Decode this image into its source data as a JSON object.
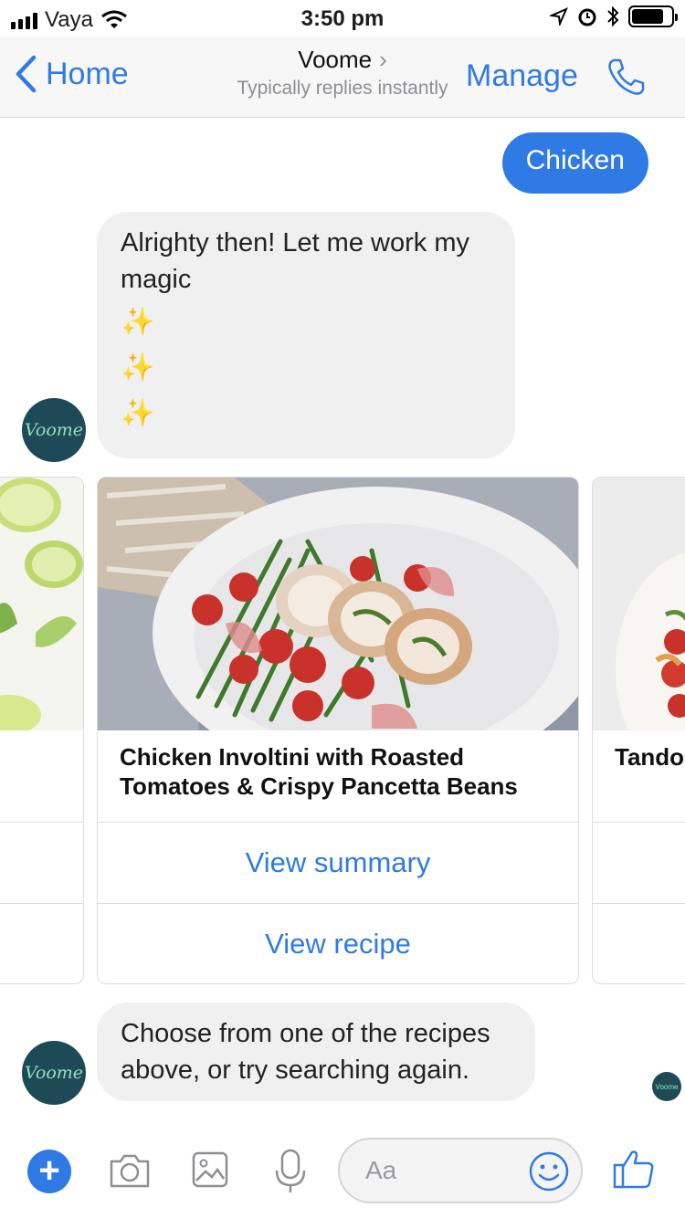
{
  "status_bar": {
    "carrier": "Vaya",
    "time": "3:50 pm"
  },
  "nav": {
    "back_label": "Home",
    "title": "Voome",
    "subtitle": "Typically replies instantly",
    "manage_label": "Manage"
  },
  "messages": {
    "outgoing": "Chicken",
    "bot_1": "Alrighty then! Let me work my magic",
    "sparkles": [
      "✨",
      "✨",
      "✨"
    ],
    "bot_2": "Choose from one of the recipes above, or try searching again."
  },
  "avatar_label": "Voome",
  "seen_label": "Voome",
  "cards": {
    "main": {
      "title": "Chicken Involtini with Roasted Tomatoes & Crispy Pancetta Beans",
      "button_1": "View summary",
      "button_2": "View recipe"
    },
    "next": {
      "title": "Tando"
    }
  },
  "composer": {
    "placeholder": "Aa"
  },
  "colors": {
    "accent": "#2f7ae5",
    "bubble_in": "#f0f0f0",
    "avatar_bg": "#1e4a58"
  }
}
